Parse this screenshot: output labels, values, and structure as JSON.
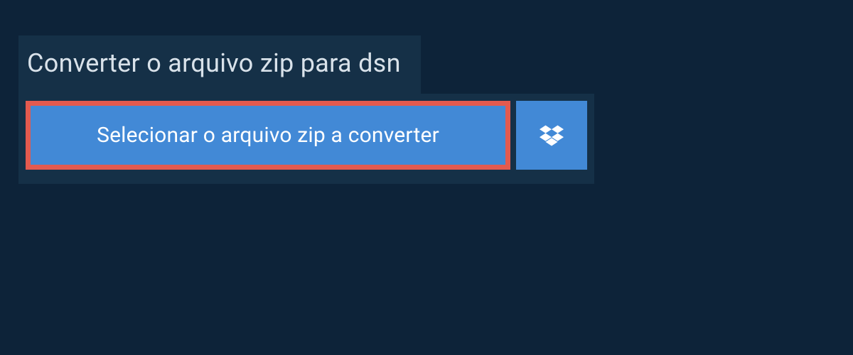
{
  "header": {
    "title": "Converter o arquivo zip para dsn"
  },
  "actions": {
    "select_label": "Selecionar o arquivo zip a converter"
  },
  "colors": {
    "page_bg": "#0d2339",
    "panel_bg": "#153047",
    "button_bg": "#4289d6",
    "highlight_border": "#e35a4f",
    "text_light": "#d9e2ea"
  }
}
